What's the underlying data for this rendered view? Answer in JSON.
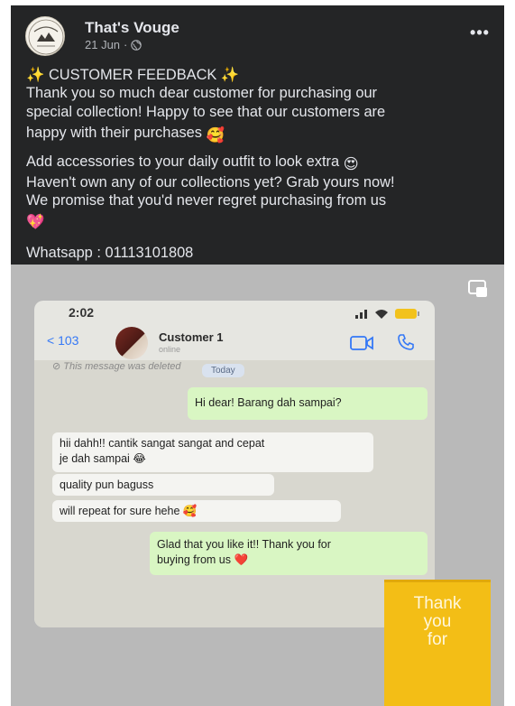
{
  "post": {
    "page_name": "That's Vouge",
    "date": "21 Jun",
    "more_label": "•••",
    "lines": {
      "l1": "✨ CUSTOMER FEEDBACK ✨",
      "l2": "Thank you so much dear customer for purchasing our",
      "l3": "special collection! Happy to see that our customers are",
      "l4": "happy with their purchases",
      "l5": "Add accessories to your daily outfit to look extra",
      "l6": "Haven't own any of our collections yet? Grab yours now!",
      "l7": "We promise that you'd never regret purchasing from us",
      "l8": "Whatsapp : 01113101808"
    },
    "emojis": {
      "e1": "🥰",
      "e2": "😍",
      "e3": "💖"
    }
  },
  "chat": {
    "status_time": "2:02",
    "back_label": "< 103",
    "contact_name": "Customer 1",
    "contact_status": "online",
    "deleted_text": "⊘ This message was deleted",
    "date_pill": "Today",
    "messages": [
      {
        "dir": "out",
        "text": "Hi dear! Barang dah sampai?"
      },
      {
        "dir": "in",
        "text": "hii dahh!! cantik sangat sangat and cepat"
      },
      {
        "dir": "in",
        "text": "je dah sampai 😂"
      },
      {
        "dir": "in",
        "text": "quality pun baguss"
      },
      {
        "dir": "in",
        "text": "will repeat for sure hehe 🥰"
      },
      {
        "dir": "out",
        "text": "Glad that you like it!! Thank you for"
      },
      {
        "dir": "out",
        "text": "buying from us ❤️"
      }
    ]
  },
  "sticker": {
    "line1": "Thank",
    "line2": "you",
    "line3": "for"
  },
  "colors": {
    "post_bg": "#242526",
    "text_primary": "#e4e6eb",
    "text_secondary": "#b0b3b8",
    "bubble_out": "#d9f6c3",
    "bubble_in": "#f4f4f1",
    "sticker": "#f3be16"
  }
}
